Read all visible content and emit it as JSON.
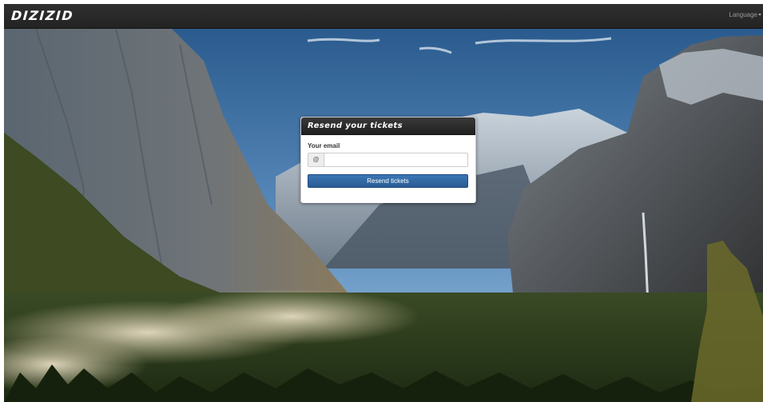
{
  "navbar": {
    "brand": "DIZIZID",
    "language_label": "Language"
  },
  "resend_panel": {
    "title": "Resend your tickets",
    "email_label": "Your email",
    "email_addon": "@",
    "email_value": "",
    "email_placeholder": "",
    "submit_label": "Resend tickets"
  },
  "icons": {
    "email_addon": "at-sign-icon",
    "language_dropdown": "caret-down-icon"
  },
  "colors": {
    "navbar": "#262626",
    "panel_header": "#2b2b2b",
    "primary_button": "#2f67a3",
    "sky": "#3f6f9c"
  }
}
